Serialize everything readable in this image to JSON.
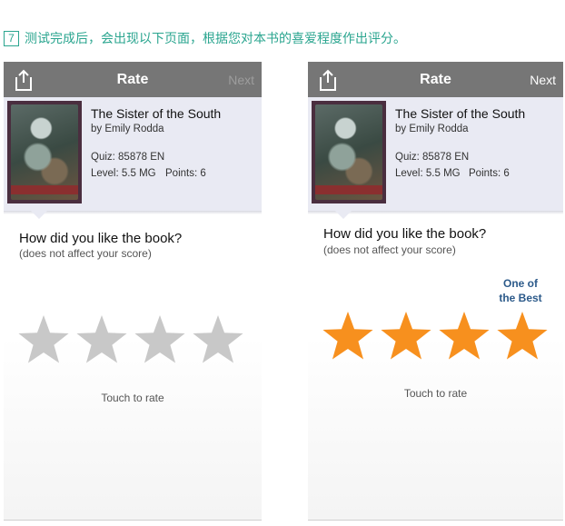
{
  "caption": {
    "step": "7",
    "text": "测试完成后，会出现以下页面，根据您对本书的喜爱程度作出评分。"
  },
  "colors": {
    "caption": "#2aa58f",
    "topbar": "#767676",
    "panel": "#e9eaf3",
    "star_empty": "#c8c8c8",
    "star_filled": "#f7901e",
    "tooltip": "#2c5a8a"
  },
  "screens": [
    {
      "topbar": {
        "share_icon": "share-icon",
        "title": "Rate",
        "next_label": "Next",
        "next_enabled": false
      },
      "book": {
        "title": "The Sister of the South",
        "author": "by Emily Rodda",
        "quiz": "Quiz: 85878 EN",
        "level": "Level: 5.5 MG",
        "points": "Points: 6"
      },
      "question": "How did you like the book?",
      "question_sub": "(does not affect your score)",
      "rating": {
        "max": 4,
        "selected": 0
      },
      "tooltip": "",
      "touch_label": "Touch to rate"
    },
    {
      "topbar": {
        "share_icon": "share-icon",
        "title": "Rate",
        "next_label": "Next",
        "next_enabled": true
      },
      "book": {
        "title": "The Sister of the South",
        "author": "by Emily Rodda",
        "quiz": "Quiz: 85878 EN",
        "level": "Level: 5.5 MG",
        "points": "Points: 6"
      },
      "question": "How did you like the book?",
      "question_sub": "(does not affect your score)",
      "rating": {
        "max": 4,
        "selected": 4
      },
      "tooltip": "One of the Best",
      "touch_label": "Touch to rate"
    }
  ]
}
